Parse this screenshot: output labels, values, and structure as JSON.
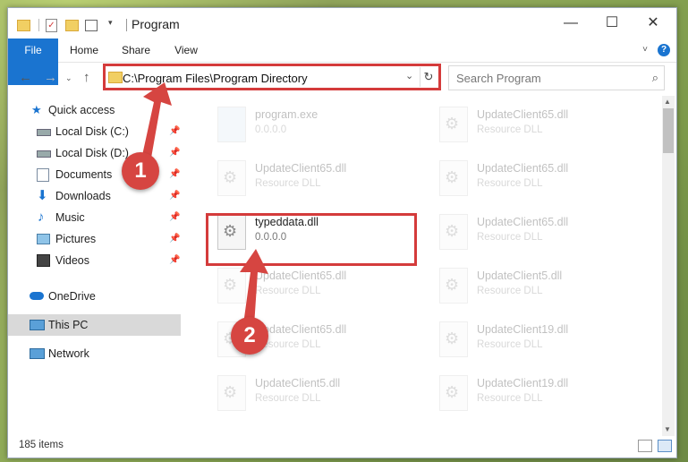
{
  "window": {
    "title": "Program",
    "controls": {
      "minimize": "—",
      "maximize": "☐",
      "close": "✕"
    }
  },
  "ribbon": {
    "tabs": [
      {
        "label": "File"
      },
      {
        "label": "Home"
      },
      {
        "label": "Share"
      },
      {
        "label": "View"
      }
    ]
  },
  "address": {
    "path": "C:\\Program Files\\Program Directory",
    "search_placeholder": "Search Program"
  },
  "sidebar": {
    "quick_access": "Quick access",
    "items": [
      {
        "label": "Local Disk (C:)",
        "icon": "drive-icon"
      },
      {
        "label": "Local Disk (D:)",
        "icon": "drive-icon"
      },
      {
        "label": "Documents",
        "icon": "documents-icon"
      },
      {
        "label": "Downloads",
        "icon": "downloads-icon"
      },
      {
        "label": "Music",
        "icon": "music-icon"
      },
      {
        "label": "Pictures",
        "icon": "pictures-icon"
      },
      {
        "label": "Videos",
        "icon": "videos-icon"
      }
    ],
    "onedrive": "OneDrive",
    "this_pc": "This PC",
    "network": "Network"
  },
  "files": {
    "left": [
      {
        "name": "program.exe",
        "sub": "0.0.0.0"
      },
      {
        "name": "UpdateClient65.dll",
        "sub": "Resource DLL"
      },
      {
        "name": "typeddata.dll",
        "sub": "0.0.0.0"
      },
      {
        "name": "UpdateClient65.dll",
        "sub": "Resource DLL"
      },
      {
        "name": "UpdateClient65.dll",
        "sub": "Resource DLL"
      },
      {
        "name": "UpdateClient5.dll",
        "sub": "Resource DLL"
      }
    ],
    "right": [
      {
        "name": "UpdateClient65.dll",
        "sub": "Resource DLL"
      },
      {
        "name": "UpdateClient65.dll",
        "sub": "Resource DLL"
      },
      {
        "name": "UpdateClient65.dll",
        "sub": "Resource DLL"
      },
      {
        "name": "UpdateClient5.dll",
        "sub": "Resource DLL"
      },
      {
        "name": "UpdateClient19.dll",
        "sub": "Resource DLL"
      },
      {
        "name": "UpdateClient19.dll",
        "sub": "Resource DLL"
      }
    ]
  },
  "status": {
    "items": "185 items"
  },
  "callouts": {
    "one": "1",
    "two": "2"
  },
  "colors": {
    "accent": "#1a74d0",
    "highlight": "#d43b3b"
  }
}
